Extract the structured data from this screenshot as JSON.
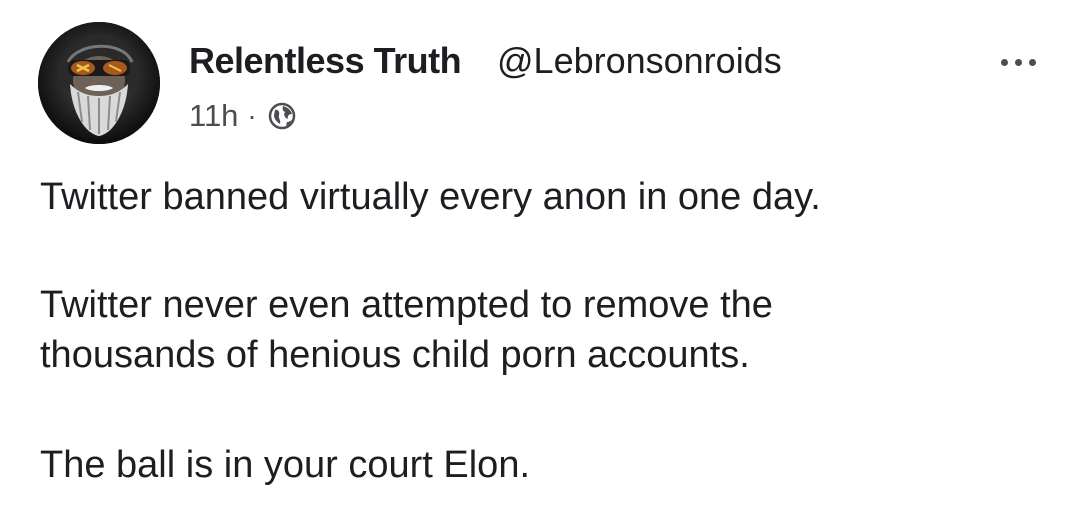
{
  "post": {
    "author": {
      "name": "Relentless Truth",
      "handle": "@Lebronsonroids",
      "avatar_icon": "avatar-bearded-man"
    },
    "meta": {
      "time": "11h",
      "separator": "·",
      "privacy_icon": "globe-icon"
    },
    "more_icon": "more-dots-icon",
    "paragraphs": [
      [
        "Twitter banned virtually every anon in one day."
      ],
      [
        "Twitter never even attempted to remove the",
        "thousands of henious child porn accounts."
      ],
      [
        "The ball is in your court Elon."
      ]
    ]
  },
  "colors": {
    "text": "#1c1e21",
    "secondary": "#4a4d52",
    "background": "#ffffff"
  }
}
